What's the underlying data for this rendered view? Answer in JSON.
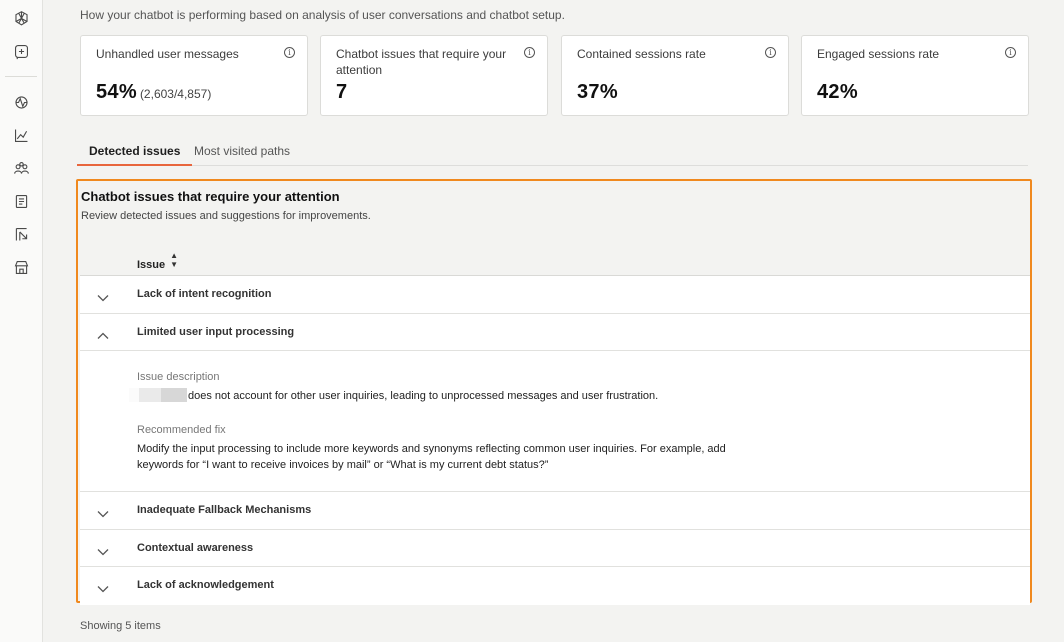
{
  "sidebar": {
    "icons": [
      "openai-logo-icon",
      "chatbot-icon",
      "activity-icon",
      "analytics-icon",
      "users-icon",
      "notebook-icon",
      "routing-icon",
      "store-icon"
    ]
  },
  "header": {
    "subtitle": "How your chatbot is performing based on analysis of user conversations and chatbot setup."
  },
  "kpis": [
    {
      "title": "Unhandled user messages",
      "value": "54%",
      "sub": "(2,603/4,857)"
    },
    {
      "title": "Chatbot issues that require your attention",
      "value": "7",
      "sub": ""
    },
    {
      "title": "Contained sessions rate",
      "value": "37%",
      "sub": ""
    },
    {
      "title": "Engaged sessions rate",
      "value": "42%",
      "sub": ""
    }
  ],
  "tabs": [
    {
      "label": "Detected issues",
      "active": true
    },
    {
      "label": "Most visited paths",
      "active": false
    }
  ],
  "panel": {
    "title": "Chatbot issues that require your attention",
    "description": "Review detected issues and suggestions for improvements.",
    "column_header": "Issue",
    "rows": [
      {
        "label": "Lack of intent recognition",
        "expanded": false
      },
      {
        "label": "Limited user input processing",
        "expanded": true
      },
      {
        "label": "Inadequate Fallback Mechanisms",
        "expanded": false
      },
      {
        "label": "Contextual awareness",
        "expanded": false
      },
      {
        "label": "Lack of acknowledgement",
        "expanded": false
      }
    ],
    "detail": {
      "description_label": "Issue description",
      "description_text": "does not account for other user inquiries, leading to unprocessed messages and user frustration.",
      "fix_label": "Recommended fix",
      "fix_text_line1": "Modify the input processing to include more keywords and synonyms reflecting common user inquiries. For example, add",
      "fix_text_line2": "keywords for “I want to receive invoices by mail” or “What is my current debt status?”"
    }
  },
  "footer": {
    "text": "Showing 5 items"
  },
  "colors": {
    "accent": "#e8663d",
    "highlight_border": "#f0891e"
  }
}
